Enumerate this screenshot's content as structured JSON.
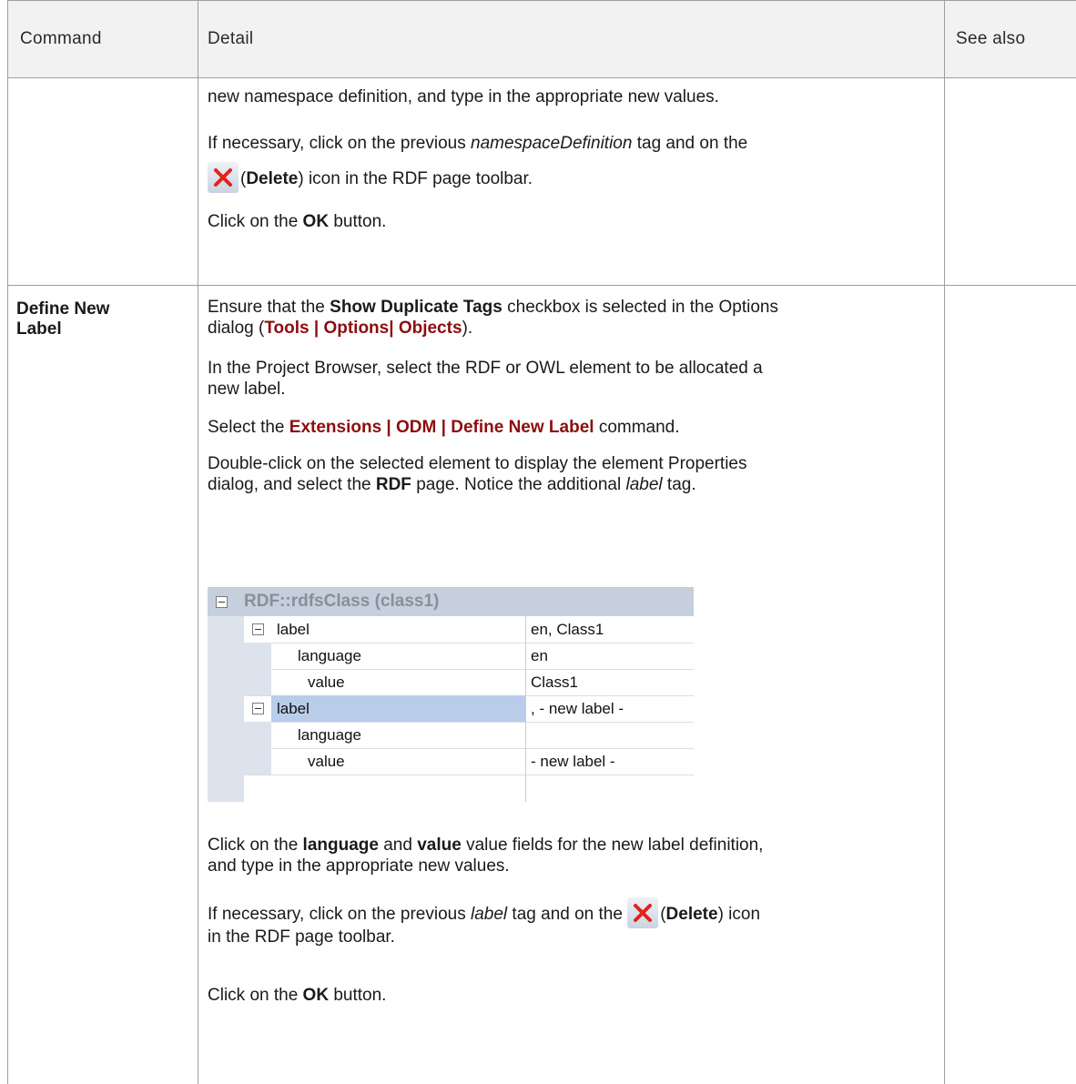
{
  "header": {
    "col_command": "Command",
    "col_detail": "Detail",
    "col_see_also": "See also"
  },
  "row1": {
    "p1": "new namespace definition, and type in the appropriate new values.",
    "p2_a": "If necessary, click on the previous ",
    "p2_i": "namespaceDefinition",
    "p2_b": " tag and on the",
    "p3_a": "(",
    "p3_bold": "Delete",
    "p3_b": ") icon in the RDF page toolbar.",
    "p4_a": "Click on the ",
    "p4_bold": "OK",
    "p4_b": " button."
  },
  "row2": {
    "command_line1": "Define New",
    "command_line2": "Label",
    "p1_a": "Ensure that the ",
    "p1_bold": "Show Duplicate Tags",
    "p1_b": " checkbox is selected in the Options",
    "p1_c": "dialog (",
    "p1_ui": "Tools | Options| Objects",
    "p1_d": ").",
    "p2_line1": "In the Project Browser, select the RDF or OWL element to be allocated a",
    "p2_line2": "new label.",
    "p3_a": "Select the ",
    "p3_ui": "Extensions | ODM | Define New Label",
    "p3_b": " command.",
    "p4_line1": "Double-click on the selected element to display the element Properties",
    "p4_a": "dialog, and select the ",
    "p4_bold": "RDF",
    "p4_b": " page. Notice the additional ",
    "p4_i": "label",
    "p4_c": " tag.",
    "p5_a": "Click on the ",
    "p5_bold1": "language",
    "p5_b": " and ",
    "p5_bold2": "value",
    "p5_c": " value fields for the new label definition,",
    "p5_line2": "and type in the appropriate new values.",
    "p6_a": "If necessary, click on the previous ",
    "p6_i": "label",
    "p6_b": " tag and on the ",
    "p6_c": "(",
    "p6_bold": "Delete",
    "p6_d": ") icon",
    "p6_line2": "in the RDF page toolbar.",
    "p7_a": "Click on the ",
    "p7_bold": "OK",
    "p7_b": " button."
  },
  "property_grid": {
    "title": "RDF::rdfsClass (class1)",
    "rows": [
      {
        "name": "label",
        "value": "en, Class1"
      },
      {
        "name": "language",
        "value": "en"
      },
      {
        "name": "value",
        "value": "Class1"
      },
      {
        "name": "label",
        "value": ", - new label -"
      },
      {
        "name": "language",
        "value": ""
      },
      {
        "name": "value",
        "value": "- new label -"
      }
    ]
  },
  "icons": {
    "delete": "delete-x-icon",
    "collapse": "collapse-minus-icon"
  },
  "colors": {
    "ui_path": "#8b0e0e",
    "grid_lines": "#9e9e9e",
    "header_bg": "#f2f2f2",
    "delete_icon": "#e0241b",
    "selected_row": "#b9cdea",
    "grid_header": "#c5cfdd"
  }
}
